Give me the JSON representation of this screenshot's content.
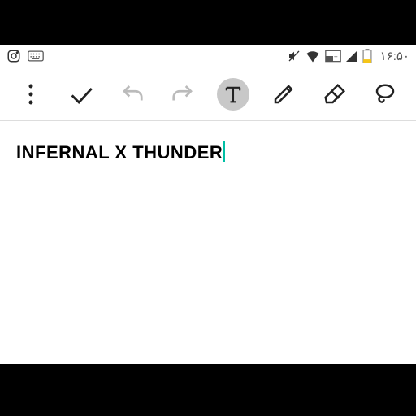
{
  "statusbar": {
    "clock": "۱۶:۵۰"
  },
  "content": {
    "text": "INFERNAL X THUNDER"
  },
  "icons": {
    "instagram": "instagram-icon",
    "keyboard": "keyboard-icon",
    "mute": "mute-icon",
    "wifi": "wifi-icon",
    "signal1": "signal-icon",
    "signal2": "signal-icon",
    "battery": "battery-icon"
  },
  "toolbar": {
    "more": "more",
    "confirm": "confirm",
    "undo": "undo",
    "redo": "redo",
    "text": "text",
    "pen": "pen",
    "eraser": "eraser",
    "lasso": "lasso"
  }
}
